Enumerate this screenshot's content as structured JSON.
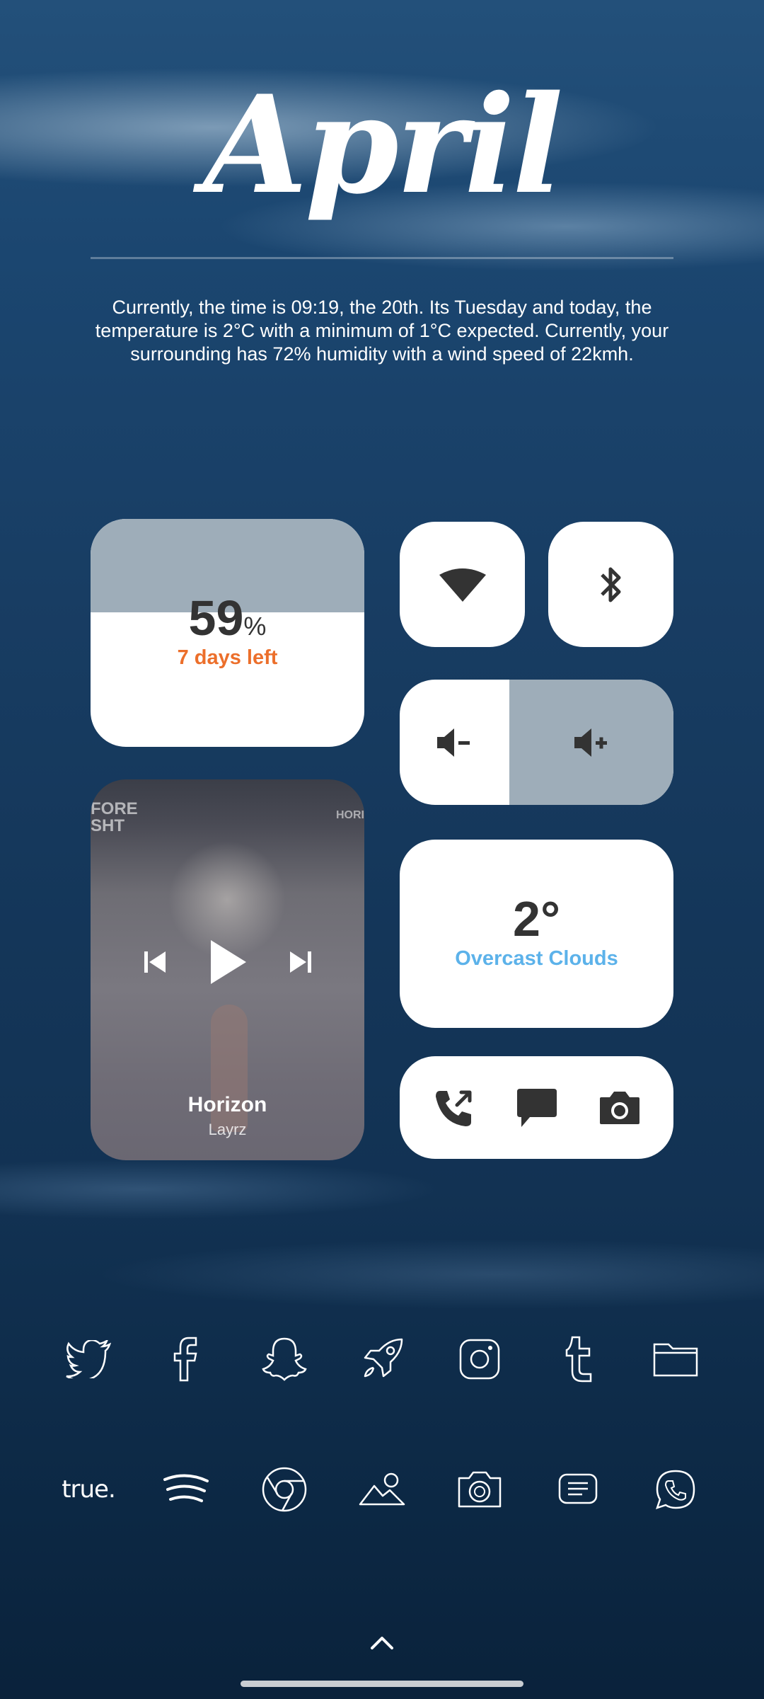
{
  "header": {
    "title": "April",
    "summary": "Currently, the time is 09:19, the 20th. Its Tuesday and today, the temperature is 2°C with a minimum of 1°C expected. Currently, your surrounding has 72% humidity with a wind speed of 22kmh."
  },
  "battery": {
    "percent_value": "59",
    "percent_sign": "%",
    "days_left": "7 days left",
    "level": 0.59,
    "color_accent": "#ec6f2b"
  },
  "toggles": {
    "wifi_icon": "wifi-icon",
    "bluetooth_icon": "bluetooth-icon"
  },
  "volume": {
    "down_icon": "volume-down-icon",
    "up_icon": "volume-up-icon",
    "level": 0.6
  },
  "music": {
    "cover_text_left": "FORE\nSHT",
    "cover_text_right": "HORI",
    "song": "Horizon",
    "artist": "Layrz"
  },
  "weather": {
    "temperature": "2°",
    "condition": "Overcast Clouds",
    "condition_color": "#5cb2ea"
  },
  "quick_apps": [
    "phone-icon",
    "messages-icon",
    "camera-icon"
  ],
  "dock_row1": [
    "twitter-icon",
    "facebook-icon",
    "snapchat-icon",
    "rocket-icon",
    "instagram-icon",
    "tumblr-icon",
    "folder-icon"
  ],
  "dock_row2": {
    "true_label": "true.",
    "icons": [
      "spotify-icon",
      "chrome-icon",
      "gallery-icon",
      "camera-app-icon",
      "notes-icon",
      "whatsapp-icon"
    ]
  }
}
